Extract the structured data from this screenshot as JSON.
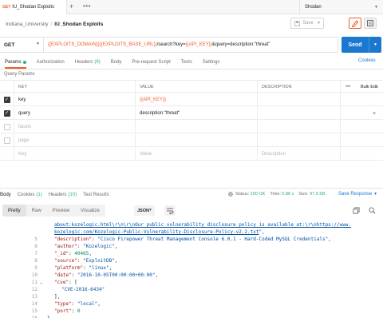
{
  "tab": {
    "method_badge": "GET",
    "name": "IU_Shodan Exploits",
    "plus": "+",
    "more": "•••"
  },
  "environment": {
    "label": "Shodan"
  },
  "breadcrumb": {
    "collection": "Indiana_University",
    "separator": "/",
    "request": "IU_Shodan Exploits"
  },
  "toolbar": {
    "save_label": "Save"
  },
  "url_bar": {
    "method": "GET",
    "url_parts": [
      {
        "text": "{{EXPLOITS_DOMAIN}}{{EXPLOITS_BASE_URL}}",
        "kind": "var"
      },
      {
        "text": "/search?key=",
        "kind": "plain"
      },
      {
        "text": "{{API_KEY}}",
        "kind": "var"
      },
      {
        "text": "&query=description:\"threat\"",
        "kind": "plain"
      }
    ],
    "send_label": "Send"
  },
  "request_tabs": {
    "params": "Params",
    "authorization": "Authorization",
    "headers": "Headers",
    "headers_count": "(9)",
    "body": "Body",
    "pre_request": "Pre-request Script",
    "tests": "Tests",
    "settings": "Settings",
    "cookies": "Cookies"
  },
  "query_params": {
    "title": "Query Params",
    "headers": {
      "key": "KEY",
      "value": "VALUE",
      "description": "DESCRIPTION",
      "more": "•••",
      "bulk_edit": "Bulk Edit"
    },
    "rows": [
      {
        "key": "key",
        "value": "{{API_KEY}}",
        "description": "",
        "checked": true,
        "value_is_var": true
      },
      {
        "key": "query",
        "value": "description:\"threat\"",
        "description": "",
        "checked": true,
        "value_is_var": false
      },
      {
        "key": "facets",
        "value": "",
        "description": "",
        "checked": false,
        "placeholder": true
      },
      {
        "key": "page",
        "value": "",
        "description": "",
        "checked": false,
        "placeholder": true
      }
    ],
    "new_row": {
      "key": "Key",
      "value": "Value",
      "description": "Description"
    }
  },
  "response_tabs": {
    "body": "Body",
    "cookies": "Cookies",
    "cookies_count": "(1)",
    "headers": "Headers",
    "headers_count": "(10)",
    "test_results": "Test Results"
  },
  "response_meta": {
    "status_label": "Status:",
    "status_value": "200 OK",
    "time_label": "Time:",
    "time_value": "6.88 s",
    "size_label": "Size:",
    "size_value": "97.9 KB",
    "save_response": "Save Response"
  },
  "body_format": {
    "pretty": "Pretty",
    "raw": "Raw",
    "preview": "Preview",
    "visualize": "Visualize",
    "language": "JSON"
  },
  "code_lines": [
    {
      "ln": "",
      "fold": "",
      "indent": 0,
      "segments": [
        {
          "t": "about:kozelogic.html\\r\\n\\r\\nOur public vulnerability disclosure policy is available at:\\r\\n",
          "c": "u"
        },
        {
          "t": "https://www.",
          "c": "u"
        }
      ]
    },
    {
      "ln": "",
      "fold": "",
      "indent": 0,
      "segments": [
        {
          "t": "kozelogic.com/Kozelogic-Public-Vulnerability-Disclosure-Policy.v2.2.txt",
          "c": "u"
        },
        {
          "t": "\",",
          "c": "s"
        }
      ]
    },
    {
      "ln": "5",
      "fold": "",
      "indent": 0,
      "segments": [
        {
          "t": "\"description\"",
          "c": "k"
        },
        {
          "t": ": ",
          "c": "p"
        },
        {
          "t": "\"Cisco Firepower Threat Management Console 6.0.1 - Hard-Coded MySQL Credentials\"",
          "c": "s"
        },
        {
          "t": ",",
          "c": "p"
        }
      ]
    },
    {
      "ln": "6",
      "fold": "",
      "indent": 0,
      "segments": [
        {
          "t": "\"author\"",
          "c": "k"
        },
        {
          "t": ": ",
          "c": "p"
        },
        {
          "t": "\"Kozelogic\"",
          "c": "s"
        },
        {
          "t": ",",
          "c": "p"
        }
      ]
    },
    {
      "ln": "7",
      "fold": "",
      "indent": 0,
      "segments": [
        {
          "t": "\"_id\"",
          "c": "k"
        },
        {
          "t": ": ",
          "c": "p"
        },
        {
          "t": "40465",
          "c": "n"
        },
        {
          "t": ",",
          "c": "p"
        }
      ]
    },
    {
      "ln": "8",
      "fold": "",
      "indent": 0,
      "segments": [
        {
          "t": "\"source\"",
          "c": "k"
        },
        {
          "t": ": ",
          "c": "p"
        },
        {
          "t": "\"ExploitDB\"",
          "c": "s"
        },
        {
          "t": ",",
          "c": "p"
        }
      ]
    },
    {
      "ln": "9",
      "fold": "",
      "indent": 0,
      "segments": [
        {
          "t": "\"platform\"",
          "c": "k"
        },
        {
          "t": ": ",
          "c": "p"
        },
        {
          "t": "\"linux\"",
          "c": "s"
        },
        {
          "t": ",",
          "c": "p"
        }
      ]
    },
    {
      "ln": "10",
      "fold": "",
      "indent": 0,
      "segments": [
        {
          "t": "\"date\"",
          "c": "k"
        },
        {
          "t": ": ",
          "c": "p"
        },
        {
          "t": "\"2016-10-05T00:00:00+00:00\"",
          "c": "s"
        },
        {
          "t": ",",
          "c": "p"
        }
      ]
    },
    {
      "ln": "11",
      "fold": "⌄",
      "indent": 0,
      "segments": [
        {
          "t": "\"cve\"",
          "c": "k"
        },
        {
          "t": ": [",
          "c": "p"
        }
      ]
    },
    {
      "ln": "12",
      "fold": "",
      "indent": 1,
      "segments": [
        {
          "t": "\"CVE-2016-6434\"",
          "c": "s"
        }
      ]
    },
    {
      "ln": "13",
      "fold": "",
      "indent": 0,
      "segments": [
        {
          "t": "],",
          "c": "p"
        }
      ]
    },
    {
      "ln": "14",
      "fold": "",
      "indent": 0,
      "segments": [
        {
          "t": "\"type\"",
          "c": "k"
        },
        {
          "t": ": ",
          "c": "p"
        },
        {
          "t": "\"local\"",
          "c": "s"
        },
        {
          "t": ",",
          "c": "p"
        }
      ]
    },
    {
      "ln": "15",
      "fold": "",
      "indent": 0,
      "segments": [
        {
          "t": "\"port\"",
          "c": "k"
        },
        {
          "t": ": ",
          "c": "p"
        },
        {
          "t": "0",
          "c": "n"
        }
      ]
    },
    {
      "ln": "16",
      "fold": "",
      "indent": -1,
      "segments": [
        {
          "t": "},",
          "c": "p"
        }
      ]
    }
  ],
  "icons": {
    "env_chevron": "chevron-down-icon",
    "edit": "pencil-icon",
    "docs": "document-icon",
    "copy": "copy-icon",
    "search": "search-icon",
    "wrap": "wrap-lines-icon",
    "delete": "close-icon"
  },
  "colors": {
    "accent": "#f15b2a",
    "send": "#1b78d0",
    "ok": "#26b47f"
  }
}
